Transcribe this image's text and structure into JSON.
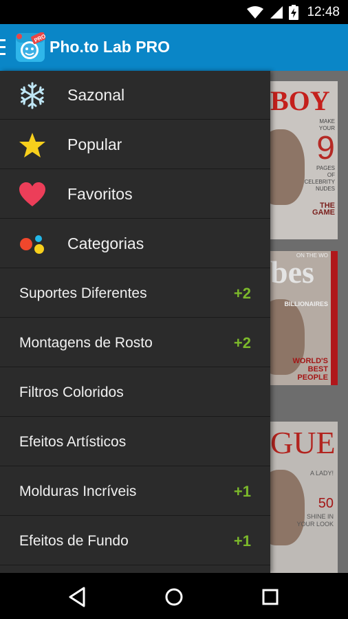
{
  "status_bar": {
    "time": "12:48",
    "icons": [
      "wifi-icon",
      "signal-icon",
      "battery-charging-icon"
    ]
  },
  "app_bar": {
    "title": "Pho.to Lab PRO",
    "logo_badge": "PRO",
    "icons": [
      "menu-icon",
      "app-logo-icon"
    ],
    "color": "#0a86c7"
  },
  "drawer": {
    "primary_items": [
      {
        "label": "Sazonal",
        "icon": "snowflake-icon"
      },
      {
        "label": "Popular",
        "icon": "star-icon"
      },
      {
        "label": "Favoritos",
        "icon": "heart-icon"
      },
      {
        "label": "Categorias",
        "icon": "dots-icon"
      }
    ],
    "category_items": [
      {
        "label": "Suportes Diferentes",
        "badge": "+2"
      },
      {
        "label": "Montagens de Rosto",
        "badge": "+2"
      },
      {
        "label": "Filtros Coloridos",
        "badge": ""
      },
      {
        "label": "Efeitos Artísticos",
        "badge": ""
      },
      {
        "label": "Molduras Incríveis",
        "badge": "+1"
      },
      {
        "label": "Efeitos de Fundo",
        "badge": "+1"
      }
    ],
    "badge_color": "#7cb92b"
  },
  "background_thumbs": [
    {
      "masthead": "BOY",
      "lines": [
        "MAKE",
        "YOUR",
        "9",
        "PAGES",
        "OF CELEBRITY",
        "NUDES",
        "THE GAME"
      ]
    },
    {
      "masthead": "bes",
      "lines": [
        "ON THE WO",
        "BILLIONAIRES",
        "WORLD'S",
        "BEST",
        "PEOPLE"
      ]
    },
    {
      "masthead": "GUE",
      "lines": [
        "A LADY!",
        "50",
        "SHINE IN",
        "YOUR LOOK"
      ]
    }
  ],
  "nav_bar": {
    "icons": [
      "back-icon",
      "home-icon",
      "recents-icon"
    ]
  }
}
